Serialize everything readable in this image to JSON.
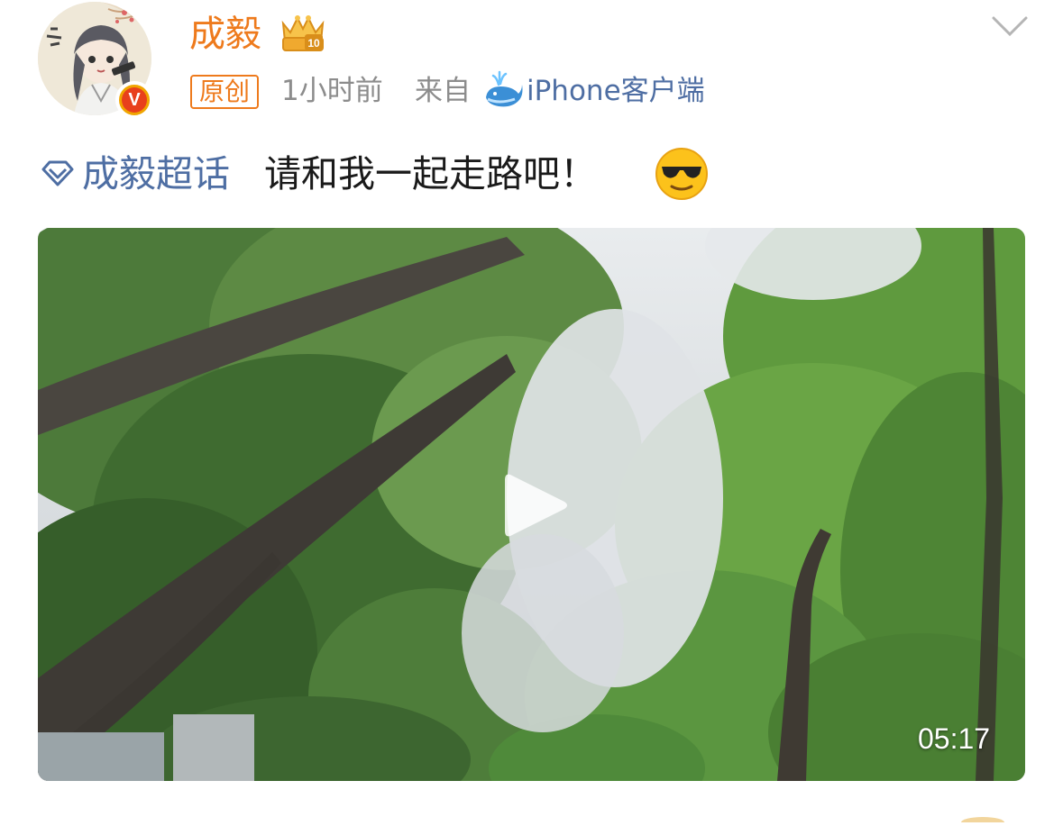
{
  "post": {
    "author": {
      "name": "成毅",
      "avatar_icon": "avatar-illustration",
      "verified_icon": "verified-v-badge",
      "verified_mark": "V",
      "badge_icon": "vip-crown-badge",
      "badge_level": "10",
      "name_color": "#ee7a1c"
    },
    "menu_icon": "chevron-down-icon",
    "meta": {
      "tag": "原创",
      "time": "1小时前",
      "from_label": "来自",
      "client_icon": "whale-icon",
      "client": "iPhone客户端"
    },
    "content": {
      "topic_icon": "diamond-topic-icon",
      "topic": "成毅超话",
      "text": "请和我一起走路吧！",
      "emoji": "sunglasses-emoji"
    },
    "video": {
      "duration": "05:17",
      "play_icon": "play-icon"
    },
    "colors": {
      "link": "#4e6ea3",
      "accent": "#ee7a1c",
      "meta": "#8c8c8c"
    }
  }
}
